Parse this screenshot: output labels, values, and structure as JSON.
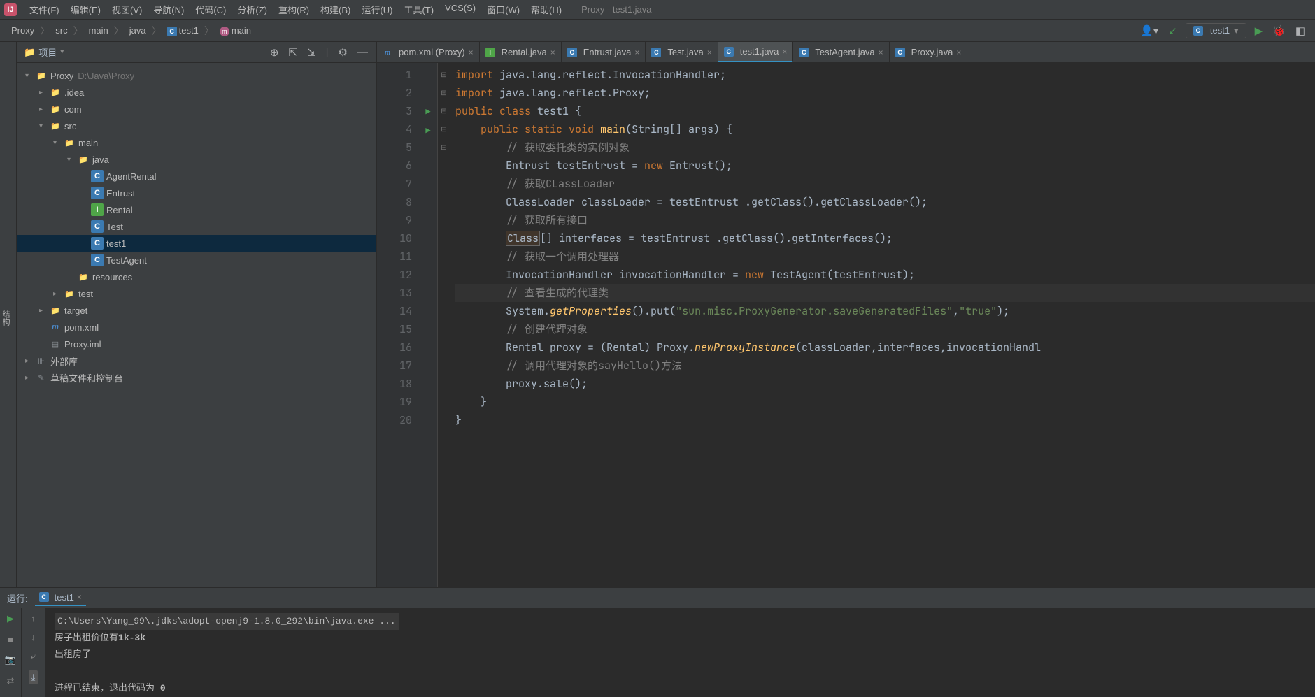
{
  "window_title": "Proxy - test1.java",
  "menu": [
    "文件(F)",
    "编辑(E)",
    "视图(V)",
    "导航(N)",
    "代码(C)",
    "分析(Z)",
    "重构(R)",
    "构建(B)",
    "运行(U)",
    "工具(T)",
    "VCS(S)",
    "窗口(W)",
    "帮助(H)"
  ],
  "breadcrumb": [
    {
      "label": "Proxy"
    },
    {
      "label": "src"
    },
    {
      "label": "main"
    },
    {
      "label": "java"
    },
    {
      "label": "test1",
      "icon": "class"
    },
    {
      "label": "main",
      "icon": "method"
    }
  ],
  "run_config": "test1",
  "project_panel": {
    "title": "项目",
    "tree": [
      {
        "depth": 0,
        "arrow": "v",
        "icon": "folder",
        "label": "Proxy",
        "suffix": "D:\\Java\\Proxy"
      },
      {
        "depth": 1,
        "arrow": ">",
        "icon": "folder",
        "label": ".idea"
      },
      {
        "depth": 1,
        "arrow": ">",
        "icon": "folder",
        "label": "com"
      },
      {
        "depth": 1,
        "arrow": "v",
        "icon": "folder",
        "label": "src"
      },
      {
        "depth": 2,
        "arrow": "v",
        "icon": "folder",
        "label": "main"
      },
      {
        "depth": 3,
        "arrow": "v",
        "icon": "src",
        "label": "java"
      },
      {
        "depth": 4,
        "arrow": "",
        "icon": "class",
        "label": "AgentRental"
      },
      {
        "depth": 4,
        "arrow": "",
        "icon": "class",
        "label": "Entrust"
      },
      {
        "depth": 4,
        "arrow": "",
        "icon": "interface",
        "label": "Rental"
      },
      {
        "depth": 4,
        "arrow": "",
        "icon": "class",
        "label": "Test"
      },
      {
        "depth": 4,
        "arrow": "",
        "icon": "class",
        "label": "test1",
        "selected": true
      },
      {
        "depth": 4,
        "arrow": "",
        "icon": "class",
        "label": "TestAgent"
      },
      {
        "depth": 3,
        "arrow": "",
        "icon": "folder",
        "label": "resources"
      },
      {
        "depth": 2,
        "arrow": ">",
        "icon": "folder",
        "label": "test"
      },
      {
        "depth": 1,
        "arrow": ">",
        "icon": "target",
        "label": "target"
      },
      {
        "depth": 1,
        "arrow": "",
        "icon": "m",
        "label": "pom.xml"
      },
      {
        "depth": 1,
        "arrow": "",
        "icon": "file",
        "label": "Proxy.iml"
      },
      {
        "depth": 0,
        "arrow": ">",
        "icon": "lib",
        "label": "外部库"
      },
      {
        "depth": 0,
        "arrow": ">",
        "icon": "scratch",
        "label": "草稿文件和控制台"
      }
    ]
  },
  "editor": {
    "tabs": [
      {
        "label": "pom.xml (Proxy)",
        "icon": "m"
      },
      {
        "label": "Rental.java",
        "icon": "interface"
      },
      {
        "label": "Entrust.java",
        "icon": "class"
      },
      {
        "label": "Test.java",
        "icon": "class"
      },
      {
        "label": "test1.java",
        "icon": "class",
        "active": true
      },
      {
        "label": "TestAgent.java",
        "icon": "class"
      },
      {
        "label": "Proxy.java",
        "icon": "class"
      }
    ],
    "lines": [
      {
        "n": 1,
        "fold": "⊟",
        "seg": [
          {
            "t": "import ",
            "c": "kw"
          },
          {
            "t": "java.lang.reflect.InvocationHandler;",
            "c": "op"
          }
        ]
      },
      {
        "n": 2,
        "fold": "⊟",
        "seg": [
          {
            "t": "import ",
            "c": "kw"
          },
          {
            "t": "java.lang.reflect.Proxy;",
            "c": "op"
          }
        ]
      },
      {
        "n": 3,
        "mark": "run",
        "seg": [
          {
            "t": "public class ",
            "c": "kw"
          },
          {
            "t": "test1 {",
            "c": "cname"
          }
        ]
      },
      {
        "n": 4,
        "mark": "run",
        "fold": "⊟",
        "seg": [
          {
            "t": "    ",
            "c": ""
          },
          {
            "t": "public static void ",
            "c": "kw"
          },
          {
            "t": "main",
            "c": "mname"
          },
          {
            "t": "(String[] args) {",
            "c": "op"
          }
        ]
      },
      {
        "n": 5,
        "seg": [
          {
            "t": "        ",
            "c": ""
          },
          {
            "t": "// 获取委托类的实例对象",
            "c": "cmt"
          }
        ]
      },
      {
        "n": 6,
        "seg": [
          {
            "t": "        ",
            "c": ""
          },
          {
            "t": "Entrust testEntrust = ",
            "c": "op"
          },
          {
            "t": "new ",
            "c": "kw"
          },
          {
            "t": "Entrust();",
            "c": "op"
          }
        ]
      },
      {
        "n": 7,
        "seg": [
          {
            "t": "        ",
            "c": ""
          },
          {
            "t": "// 获取CLassLoader",
            "c": "cmt"
          }
        ]
      },
      {
        "n": 8,
        "seg": [
          {
            "t": "        ",
            "c": ""
          },
          {
            "t": "ClassLoader classLoader = testEntrust .getClass().getClassLoader();",
            "c": "op"
          }
        ]
      },
      {
        "n": 9,
        "seg": [
          {
            "t": "        ",
            "c": ""
          },
          {
            "t": "// 获取所有接口",
            "c": "cmt"
          }
        ]
      },
      {
        "n": 10,
        "seg": [
          {
            "t": "        ",
            "c": ""
          },
          {
            "t": "Class",
            "c": "boxed"
          },
          {
            "t": "[] interfaces = testEntrust .getClass().getInterfaces();",
            "c": "op"
          }
        ]
      },
      {
        "n": 11,
        "seg": [
          {
            "t": "        ",
            "c": ""
          },
          {
            "t": "// 获取一个调用处理器",
            "c": "cmt"
          }
        ]
      },
      {
        "n": 12,
        "seg": [
          {
            "t": "        ",
            "c": ""
          },
          {
            "t": "InvocationHandler invocationHandler = ",
            "c": "op"
          },
          {
            "t": "new ",
            "c": "kw"
          },
          {
            "t": "TestAgent(testEntrust);",
            "c": "op"
          }
        ]
      },
      {
        "n": 13,
        "hl": true,
        "seg": [
          {
            "t": "        ",
            "c": ""
          },
          {
            "t": "// 查看生成的代理类",
            "c": "cmt"
          }
        ]
      },
      {
        "n": 14,
        "seg": [
          {
            "t": "        ",
            "c": ""
          },
          {
            "t": "System.",
            "c": "op"
          },
          {
            "t": "getProperties",
            "c": "mname italic"
          },
          {
            "t": "().put(",
            "c": "op"
          },
          {
            "t": "\"sun.misc.ProxyGenerator.saveGeneratedFiles\"",
            "c": "str"
          },
          {
            "t": ",",
            "c": "op"
          },
          {
            "t": "\"true\"",
            "c": "str"
          },
          {
            "t": ");",
            "c": "op"
          }
        ]
      },
      {
        "n": 15,
        "seg": [
          {
            "t": "        ",
            "c": ""
          },
          {
            "t": "// 创建代理对象",
            "c": "cmt"
          }
        ]
      },
      {
        "n": 16,
        "seg": [
          {
            "t": "        ",
            "c": ""
          },
          {
            "t": "Rental proxy = (Rental) Proxy.",
            "c": "op"
          },
          {
            "t": "newProxyInstance",
            "c": "mname italic"
          },
          {
            "t": "(classLoader,interfaces,invocationHandl",
            "c": "op"
          }
        ]
      },
      {
        "n": 17,
        "seg": [
          {
            "t": "        ",
            "c": ""
          },
          {
            "t": "// 调用代理对象的sayHello()方法",
            "c": "cmt"
          }
        ]
      },
      {
        "n": 18,
        "seg": [
          {
            "t": "        ",
            "c": ""
          },
          {
            "t": "proxy.sale();",
            "c": "op"
          }
        ]
      },
      {
        "n": 19,
        "fold": "⊟",
        "seg": [
          {
            "t": "    }",
            "c": "op"
          }
        ]
      },
      {
        "n": 20,
        "fold": "⊟",
        "seg": [
          {
            "t": "}",
            "c": "op"
          }
        ]
      }
    ]
  },
  "run_panel": {
    "label": "运行:",
    "tab": "test1",
    "console_cmd": "C:\\Users\\Yang_99\\.jdks\\adopt-openj9-1.8.0_292\\bin\\java.exe ...",
    "output": [
      {
        "pre": "房子出租价位有",
        "bold": "1k-3k"
      },
      {
        "pre": "出租房子"
      },
      {
        "pre": ""
      },
      {
        "pre": "进程已结束，退出代码为 ",
        "bold": "0"
      }
    ]
  }
}
